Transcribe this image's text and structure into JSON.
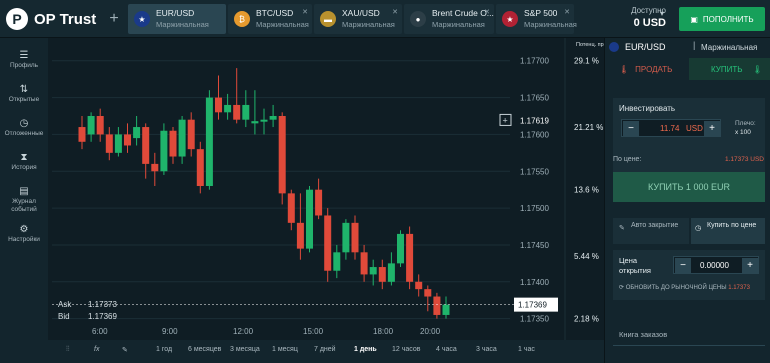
{
  "app": {
    "title": "OP Trust"
  },
  "tabs": [
    {
      "name": "EUR/USD",
      "type": "Маржинальная",
      "icon": "eu-flag-icon",
      "active": true
    },
    {
      "name": "BTC/USD",
      "type": "Маржинальная",
      "icon": "bitcoin-icon"
    },
    {
      "name": "XAU/USD",
      "type": "Маржинальная",
      "icon": "gold-icon"
    },
    {
      "name": "Brent Crude O...",
      "type": "Маржинальная",
      "icon": "oil-icon"
    },
    {
      "name": "S&P 500",
      "type": "Маржинальная",
      "icon": "us-flag-icon"
    }
  ],
  "balance": {
    "label": "Доступно",
    "value": "0 USD"
  },
  "deposit": {
    "label": "ПОПОЛНИТЬ"
  },
  "sidebar": [
    {
      "label": "Профиль",
      "icon": "menu-icon"
    },
    {
      "label": "Открытые",
      "icon": "arrows-icon"
    },
    {
      "label": "Отложенные",
      "icon": "clock-icon"
    },
    {
      "label": "История",
      "icon": "hourglass-icon"
    },
    {
      "label": "Журнал событий",
      "icon": "book-icon"
    },
    {
      "label": "Настройки",
      "icon": "gear-icon"
    }
  ],
  "chart_data": {
    "type": "candlestick",
    "yticks": [
      17700,
      17650,
      17600,
      17550,
      17500,
      17450,
      17400,
      17350
    ],
    "ytick_labels": [
      "1.17700",
      "1.17650",
      "1.17600",
      "1.17550",
      "1.17500",
      "1.17450",
      "1.17400",
      "1.17350"
    ],
    "xtick_labels": [
      "6:00",
      "9:00",
      "12:00",
      "15:00",
      "18:00",
      "20:00"
    ],
    "profit_header": "Потенц. прибыль",
    "profit_labels": [
      "29.1 %",
      "21.21 %",
      "13.6 %",
      "5.44 %",
      "2.18 %"
    ],
    "profit_levels": [
      17700,
      17610,
      17525,
      17435,
      17350
    ],
    "current_price": "1.17369",
    "hover_price": "1.17619",
    "candles": [
      [
        17610,
        17590,
        17625,
        17580
      ],
      [
        17600,
        17625,
        17630,
        17590
      ],
      [
        17625,
        17600,
        17635,
        17590
      ],
      [
        17600,
        17575,
        17610,
        17565
      ],
      [
        17575,
        17600,
        17610,
        17570
      ],
      [
        17600,
        17585,
        17615,
        17575
      ],
      [
        17595,
        17610,
        17625,
        17585
      ],
      [
        17610,
        17560,
        17615,
        17540
      ],
      [
        17560,
        17550,
        17575,
        17530
      ],
      [
        17550,
        17605,
        17615,
        17545
      ],
      [
        17605,
        17570,
        17610,
        17560
      ],
      [
        17570,
        17620,
        17625,
        17560
      ],
      [
        17620,
        17580,
        17630,
        17570
      ],
      [
        17580,
        17530,
        17590,
        17520
      ],
      [
        17530,
        17650,
        17660,
        17525
      ],
      [
        17650,
        17630,
        17680,
        17620
      ],
      [
        17630,
        17640,
        17655,
        17620
      ],
      [
        17640,
        17620,
        17690,
        17615
      ],
      [
        17620,
        17640,
        17660,
        17610
      ],
      [
        17615,
        17618,
        17660,
        17600
      ],
      [
        17618,
        17620,
        17635,
        17600
      ],
      [
        17620,
        17625,
        17640,
        17610
      ],
      [
        17625,
        17520,
        17630,
        17505
      ],
      [
        17520,
        17480,
        17525,
        17470
      ],
      [
        17480,
        17445,
        17520,
        17430
      ],
      [
        17445,
        17525,
        17530,
        17440
      ],
      [
        17525,
        17490,
        17540,
        17485
      ],
      [
        17490,
        17415,
        17500,
        17400
      ],
      [
        17415,
        17440,
        17450,
        17405
      ],
      [
        17440,
        17480,
        17485,
        17430
      ],
      [
        17480,
        17440,
        17490,
        17430
      ],
      [
        17440,
        17410,
        17450,
        17400
      ],
      [
        17410,
        17420,
        17430,
        17395
      ],
      [
        17420,
        17400,
        17430,
        17390
      ],
      [
        17400,
        17425,
        17440,
        17395
      ],
      [
        17425,
        17465,
        17470,
        17420
      ],
      [
        17465,
        17400,
        17475,
        17390
      ],
      [
        17400,
        17390,
        17410,
        17380
      ],
      [
        17390,
        17380,
        17395,
        17360
      ],
      [
        17380,
        17355,
        17385,
        17350
      ],
      [
        17355,
        17369,
        17380,
        17350
      ]
    ],
    "ylim": [
      17340,
      17720
    ]
  },
  "bottombar": {
    "tools": [
      "candles-icon",
      "function-icon",
      "brush-icon"
    ],
    "ranges": [
      "1 год",
      "6 месяцев",
      "3 месяца",
      "1 месяц",
      "7 дней",
      "1 день",
      "12 часов",
      "4 часа",
      "3 часа",
      "1 час"
    ],
    "active": "1 день"
  },
  "askbid": {
    "ask_label": "Ask",
    "ask": "1.17373",
    "bid_label": "Bid",
    "bid": "1.17369"
  },
  "panel": {
    "pair": "EUR/USD",
    "type": "Маржинальная",
    "sell": "ПРОДАТЬ",
    "buy": "КУПИТЬ",
    "invest_label": "Инвестировать",
    "amount": "11.74",
    "currency": "USD",
    "leverage_label": "Плечо:",
    "leverage": "x 100",
    "price_label": "По цене:",
    "price_value": "1.17373 USD",
    "buy_button": "КУПИТЬ 1 000 EUR",
    "auto_close": "Авто закрытие",
    "buy_at_price": "Купить по цене",
    "open_price_label": "Цена открытия",
    "open_price": "0.00000",
    "refresh_label": "ОБНОВИТЬ ДО РЫНОЧНОЙ ЦЕНЫ",
    "refresh_value": "1.17373",
    "orders": "Книга заказов"
  },
  "colors": {
    "up": "#1fb46b",
    "down": "#e04a3a",
    "accent": "#16a05a"
  }
}
